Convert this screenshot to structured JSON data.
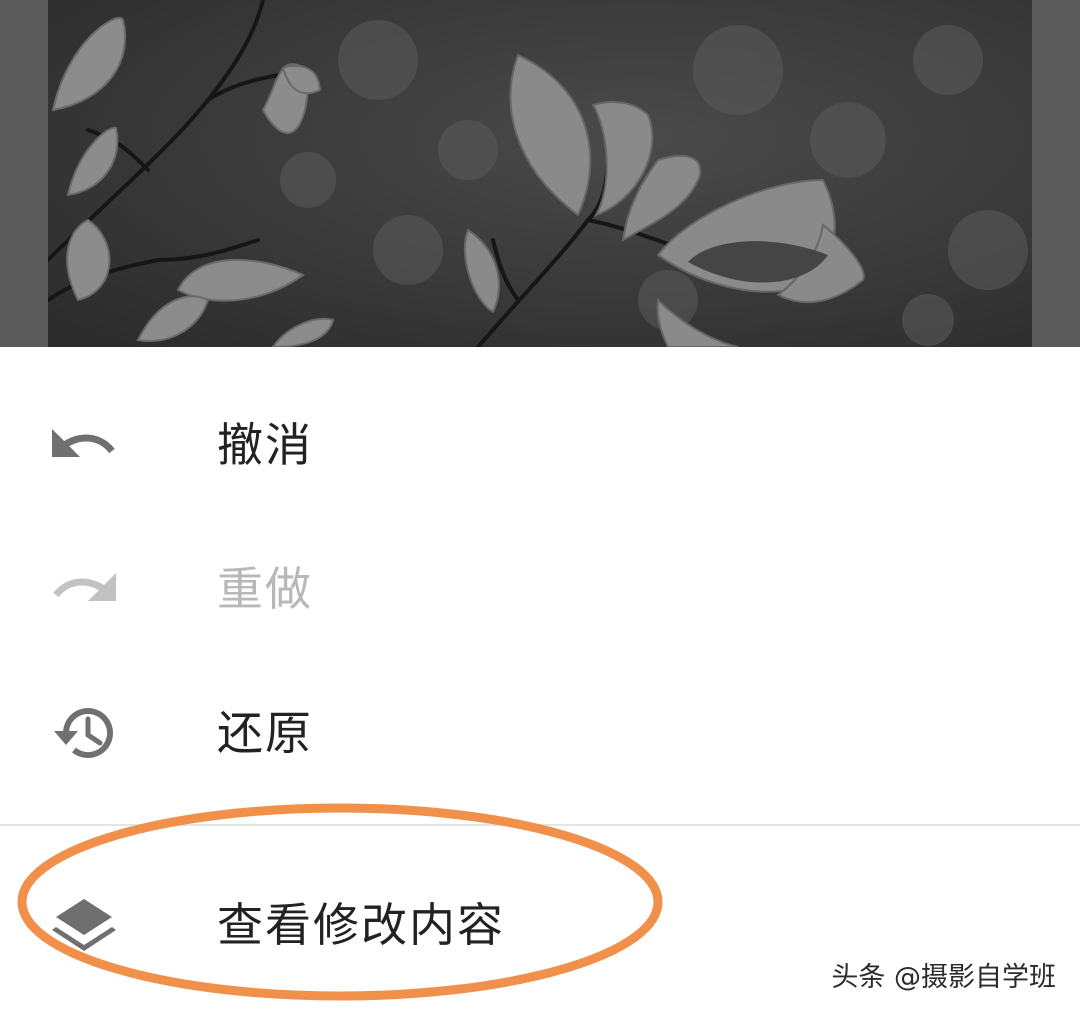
{
  "photo": {
    "icon": "leaves-photo",
    "background_color": "#5a5a5a"
  },
  "menu": {
    "items": [
      {
        "label": "撤消",
        "icon": "undo-icon",
        "enabled": true
      },
      {
        "label": "重做",
        "icon": "redo-icon",
        "enabled": false
      },
      {
        "label": "还原",
        "icon": "history-restore-icon",
        "enabled": true
      },
      {
        "label": "查看修改内容",
        "icon": "layers-icon",
        "enabled": true
      }
    ]
  },
  "annotation": {
    "highlight_color": "#f0904a"
  },
  "watermark": {
    "text": "头条 @摄影自学班"
  }
}
